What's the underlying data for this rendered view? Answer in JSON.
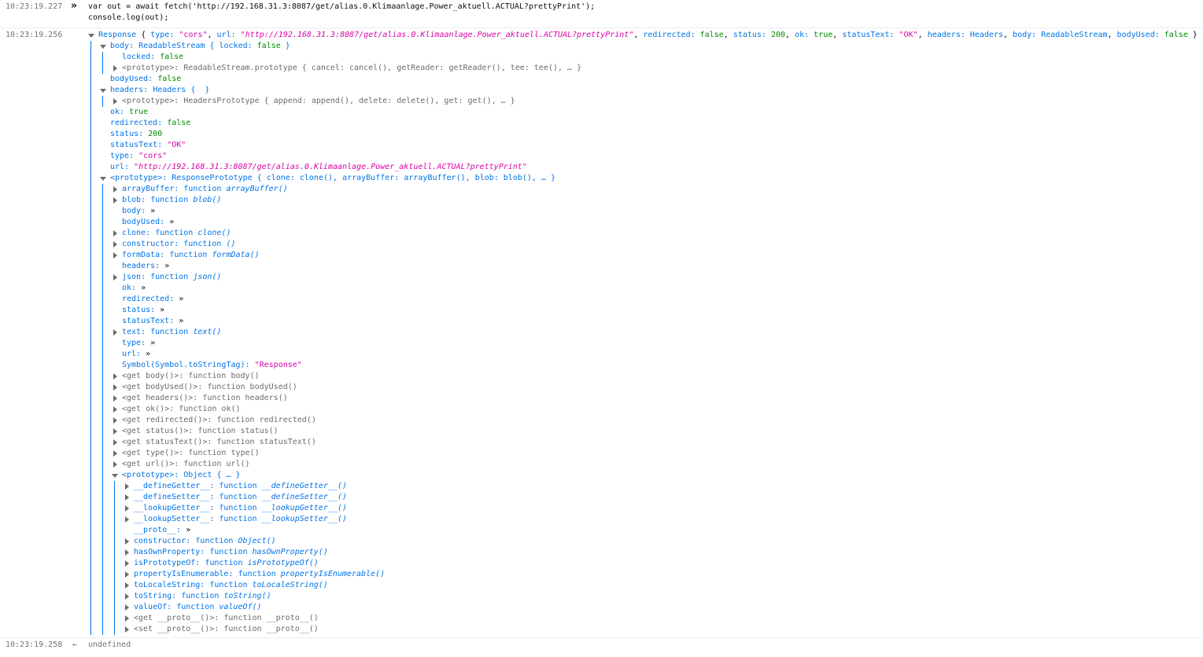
{
  "entries": {
    "input_ts": "10:23:19.227",
    "input_prompt": "»",
    "input_line1": "var out = await fetch('http://192.168.31.3:8087/get/alias.0.Klimaanlage.Power_aktuell.ACTUAL?prettyPrint');",
    "input_line2": "console.log(out);",
    "log_ts": "10:23:19.256",
    "result_ts": "10:23:19.258",
    "result_arrow": "←",
    "result_value": "undefined"
  },
  "tree": [
    {
      "indent": 0,
      "tri": "down",
      "parts": [
        [
          "obj",
          "Response "
        ],
        [
          "dk",
          "{ "
        ],
        [
          "key",
          "type: "
        ],
        [
          "str",
          "\"cors\""
        ],
        [
          "dk",
          ", "
        ],
        [
          "key",
          "url: "
        ],
        [
          "strd",
          "\"http://192.168.31.3:8087/get/alias.0.Klimaanlage.Power_aktuell.ACTUAL?prettyPrint\""
        ],
        [
          "dk",
          ", "
        ],
        [
          "key",
          "redirected: "
        ],
        [
          "bool",
          "false"
        ],
        [
          "dk",
          ", "
        ],
        [
          "key",
          "status: "
        ],
        [
          "num",
          "200"
        ],
        [
          "dk",
          ", "
        ],
        [
          "key",
          "ok: "
        ],
        [
          "bool",
          "true"
        ],
        [
          "dk",
          ", "
        ],
        [
          "key",
          "statusText: "
        ],
        [
          "str",
          "\"OK\""
        ],
        [
          "dk",
          ", "
        ],
        [
          "key",
          "headers: "
        ],
        [
          "obj",
          "Headers"
        ],
        [
          "dk",
          ", "
        ],
        [
          "key",
          "body: "
        ],
        [
          "obj",
          "ReadableStream"
        ],
        [
          "dk",
          ", "
        ],
        [
          "key",
          "bodyUsed: "
        ],
        [
          "bool",
          "false"
        ],
        [
          "dk",
          " }"
        ]
      ]
    },
    {
      "indent": 1,
      "tri": "down",
      "parts": [
        [
          "key",
          "body: "
        ],
        [
          "obj",
          "ReadableStream { "
        ],
        [
          "key",
          "locked: "
        ],
        [
          "bool",
          "false"
        ],
        [
          "obj",
          " }"
        ]
      ]
    },
    {
      "indent": 2,
      "tri": "none",
      "parts": [
        [
          "key",
          "locked: "
        ],
        [
          "bool",
          "false"
        ]
      ]
    },
    {
      "indent": 2,
      "tri": "right",
      "parts": [
        [
          "gray",
          "<prototype>: ReadableStream.prototype { cancel: cancel(), getReader: getReader(), tee: tee(), … }"
        ]
      ]
    },
    {
      "indent": 1,
      "tri": "none",
      "parts": [
        [
          "key",
          "bodyUsed: "
        ],
        [
          "bool",
          "false"
        ]
      ]
    },
    {
      "indent": 1,
      "tri": "down",
      "parts": [
        [
          "key",
          "headers: "
        ],
        [
          "obj",
          "Headers {  }"
        ]
      ]
    },
    {
      "indent": 2,
      "tri": "right",
      "parts": [
        [
          "gray",
          "<prototype>: HeadersPrototype { append: append(), delete: delete(), get: get(), … }"
        ]
      ]
    },
    {
      "indent": 1,
      "tri": "none",
      "parts": [
        [
          "key",
          "ok: "
        ],
        [
          "bool",
          "true"
        ]
      ]
    },
    {
      "indent": 1,
      "tri": "none",
      "parts": [
        [
          "key",
          "redirected: "
        ],
        [
          "bool",
          "false"
        ]
      ]
    },
    {
      "indent": 1,
      "tri": "none",
      "parts": [
        [
          "key",
          "status: "
        ],
        [
          "num",
          "200"
        ]
      ]
    },
    {
      "indent": 1,
      "tri": "none",
      "parts": [
        [
          "key",
          "statusText: "
        ],
        [
          "str",
          "\"OK\""
        ]
      ]
    },
    {
      "indent": 1,
      "tri": "none",
      "parts": [
        [
          "key",
          "type: "
        ],
        [
          "str",
          "\"cors\""
        ]
      ]
    },
    {
      "indent": 1,
      "tri": "none",
      "parts": [
        [
          "key",
          "url: "
        ],
        [
          "strd",
          "\"http://192.168.31.3:8087/get/alias.0.Klimaanlage.Power_aktuell.ACTUAL?prettyPrint\""
        ]
      ]
    },
    {
      "indent": 1,
      "tri": "down",
      "parts": [
        [
          "key",
          "<prototype>: "
        ],
        [
          "obj",
          "ResponsePrototype { "
        ],
        [
          "key",
          "clone: "
        ],
        [
          "fn",
          "clone()"
        ],
        [
          "obj",
          ", "
        ],
        [
          "key",
          "arrayBuffer: "
        ],
        [
          "fn",
          "arrayBuffer()"
        ],
        [
          "obj",
          ", "
        ],
        [
          "key",
          "blob: "
        ],
        [
          "fn",
          "blob()"
        ],
        [
          "obj",
          ", … }"
        ]
      ]
    },
    {
      "indent": 2,
      "tri": "right",
      "parts": [
        [
          "key",
          "arrayBuffer: "
        ],
        [
          "fn",
          "function "
        ],
        [
          "fnname",
          "arrayBuffer()"
        ]
      ]
    },
    {
      "indent": 2,
      "tri": "right",
      "parts": [
        [
          "key",
          "blob: "
        ],
        [
          "fn",
          "function "
        ],
        [
          "fnname",
          "blob()"
        ]
      ]
    },
    {
      "indent": 2,
      "tri": "none",
      "parts": [
        [
          "key",
          "body: "
        ],
        [
          "dk",
          "»"
        ]
      ]
    },
    {
      "indent": 2,
      "tri": "none",
      "parts": [
        [
          "key",
          "bodyUsed: "
        ],
        [
          "dk",
          "»"
        ]
      ]
    },
    {
      "indent": 2,
      "tri": "right",
      "parts": [
        [
          "key",
          "clone: "
        ],
        [
          "fn",
          "function "
        ],
        [
          "fnname",
          "clone()"
        ]
      ]
    },
    {
      "indent": 2,
      "tri": "right",
      "parts": [
        [
          "key",
          "constructor: "
        ],
        [
          "fn",
          "function "
        ],
        [
          "fnname",
          "()"
        ]
      ]
    },
    {
      "indent": 2,
      "tri": "right",
      "parts": [
        [
          "key",
          "formData: "
        ],
        [
          "fn",
          "function "
        ],
        [
          "fnname",
          "formData()"
        ]
      ]
    },
    {
      "indent": 2,
      "tri": "none",
      "parts": [
        [
          "key",
          "headers: "
        ],
        [
          "dk",
          "»"
        ]
      ]
    },
    {
      "indent": 2,
      "tri": "right",
      "parts": [
        [
          "key",
          "json: "
        ],
        [
          "fn",
          "function "
        ],
        [
          "fnname",
          "json()"
        ]
      ]
    },
    {
      "indent": 2,
      "tri": "none",
      "parts": [
        [
          "key",
          "ok: "
        ],
        [
          "dk",
          "»"
        ]
      ]
    },
    {
      "indent": 2,
      "tri": "none",
      "parts": [
        [
          "key",
          "redirected: "
        ],
        [
          "dk",
          "»"
        ]
      ]
    },
    {
      "indent": 2,
      "tri": "none",
      "parts": [
        [
          "key",
          "status: "
        ],
        [
          "dk",
          "»"
        ]
      ]
    },
    {
      "indent": 2,
      "tri": "none",
      "parts": [
        [
          "key",
          "statusText: "
        ],
        [
          "dk",
          "»"
        ]
      ]
    },
    {
      "indent": 2,
      "tri": "right",
      "parts": [
        [
          "key",
          "text: "
        ],
        [
          "fn",
          "function "
        ],
        [
          "fnname",
          "text()"
        ]
      ]
    },
    {
      "indent": 2,
      "tri": "none",
      "parts": [
        [
          "key",
          "type: "
        ],
        [
          "dk",
          "»"
        ]
      ]
    },
    {
      "indent": 2,
      "tri": "none",
      "parts": [
        [
          "key",
          "url: "
        ],
        [
          "dk",
          "»"
        ]
      ]
    },
    {
      "indent": 2,
      "tri": "none",
      "parts": [
        [
          "key",
          "Symbol(Symbol.toStringTag): "
        ],
        [
          "str",
          "\"Response\""
        ]
      ]
    },
    {
      "indent": 2,
      "tri": "right",
      "parts": [
        [
          "gray",
          "<get body()>: function body()"
        ]
      ]
    },
    {
      "indent": 2,
      "tri": "right",
      "parts": [
        [
          "gray",
          "<get bodyUsed()>: function bodyUsed()"
        ]
      ]
    },
    {
      "indent": 2,
      "tri": "right",
      "parts": [
        [
          "gray",
          "<get headers()>: function headers()"
        ]
      ]
    },
    {
      "indent": 2,
      "tri": "right",
      "parts": [
        [
          "gray",
          "<get ok()>: function ok()"
        ]
      ]
    },
    {
      "indent": 2,
      "tri": "right",
      "parts": [
        [
          "gray",
          "<get redirected()>: function redirected()"
        ]
      ]
    },
    {
      "indent": 2,
      "tri": "right",
      "parts": [
        [
          "gray",
          "<get status()>: function status()"
        ]
      ]
    },
    {
      "indent": 2,
      "tri": "right",
      "parts": [
        [
          "gray",
          "<get statusText()>: function statusText()"
        ]
      ]
    },
    {
      "indent": 2,
      "tri": "right",
      "parts": [
        [
          "gray",
          "<get type()>: function type()"
        ]
      ]
    },
    {
      "indent": 2,
      "tri": "right",
      "parts": [
        [
          "gray",
          "<get url()>: function url()"
        ]
      ]
    },
    {
      "indent": 2,
      "tri": "down",
      "parts": [
        [
          "key",
          "<prototype>: "
        ],
        [
          "obj",
          "Object { … }"
        ]
      ]
    },
    {
      "indent": 3,
      "tri": "right",
      "parts": [
        [
          "key",
          "__defineGetter__: "
        ],
        [
          "fn",
          "function "
        ],
        [
          "fnname",
          "__defineGetter__()"
        ]
      ]
    },
    {
      "indent": 3,
      "tri": "right",
      "parts": [
        [
          "key",
          "__defineSetter__: "
        ],
        [
          "fn",
          "function "
        ],
        [
          "fnname",
          "__defineSetter__()"
        ]
      ]
    },
    {
      "indent": 3,
      "tri": "right",
      "parts": [
        [
          "key",
          "__lookupGetter__: "
        ],
        [
          "fn",
          "function "
        ],
        [
          "fnname",
          "__lookupGetter__()"
        ]
      ]
    },
    {
      "indent": 3,
      "tri": "right",
      "parts": [
        [
          "key",
          "__lookupSetter__: "
        ],
        [
          "fn",
          "function "
        ],
        [
          "fnname",
          "__lookupSetter__()"
        ]
      ]
    },
    {
      "indent": 3,
      "tri": "none",
      "parts": [
        [
          "key",
          "__proto__: "
        ],
        [
          "dk",
          "»"
        ]
      ]
    },
    {
      "indent": 3,
      "tri": "right",
      "parts": [
        [
          "key",
          "constructor: "
        ],
        [
          "fn",
          "function "
        ],
        [
          "fnname",
          "Object()"
        ]
      ]
    },
    {
      "indent": 3,
      "tri": "right",
      "parts": [
        [
          "key",
          "hasOwnProperty: "
        ],
        [
          "fn",
          "function "
        ],
        [
          "fnname",
          "hasOwnProperty()"
        ]
      ]
    },
    {
      "indent": 3,
      "tri": "right",
      "parts": [
        [
          "key",
          "isPrototypeOf: "
        ],
        [
          "fn",
          "function "
        ],
        [
          "fnname",
          "isPrototypeOf()"
        ]
      ]
    },
    {
      "indent": 3,
      "tri": "right",
      "parts": [
        [
          "key",
          "propertyIsEnumerable: "
        ],
        [
          "fn",
          "function "
        ],
        [
          "fnname",
          "propertyIsEnumerable()"
        ]
      ]
    },
    {
      "indent": 3,
      "tri": "right",
      "parts": [
        [
          "key",
          "toLocaleString: "
        ],
        [
          "fn",
          "function "
        ],
        [
          "fnname",
          "toLocaleString()"
        ]
      ]
    },
    {
      "indent": 3,
      "tri": "right",
      "parts": [
        [
          "key",
          "toString: "
        ],
        [
          "fn",
          "function "
        ],
        [
          "fnname",
          "toString()"
        ]
      ]
    },
    {
      "indent": 3,
      "tri": "right",
      "parts": [
        [
          "key",
          "valueOf: "
        ],
        [
          "fn",
          "function "
        ],
        [
          "fnname",
          "valueOf()"
        ]
      ]
    },
    {
      "indent": 3,
      "tri": "right",
      "parts": [
        [
          "gray",
          "<get __proto__()>: function __proto__()"
        ]
      ]
    },
    {
      "indent": 3,
      "tri": "right",
      "parts": [
        [
          "gray",
          "<set __proto__()>: function __proto__()"
        ]
      ]
    }
  ]
}
